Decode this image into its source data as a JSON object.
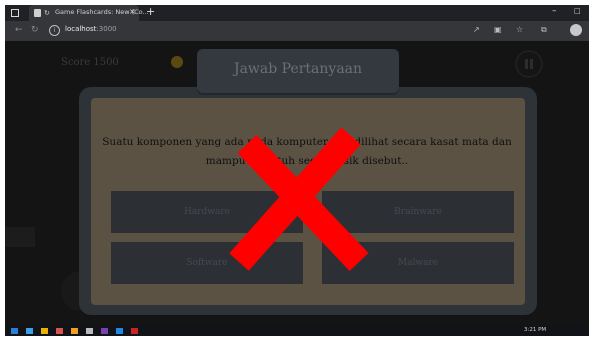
{
  "browser": {
    "tab_title": "Game Flashcards: New (Co...",
    "new_tab": "+",
    "close_tab": "×",
    "url_host": "localhost",
    "url_port": ":3000",
    "win_min": "–",
    "win_max": "□"
  },
  "hud": {
    "score": "Score 1500"
  },
  "modal": {
    "title": "Jawab Pertanyaan",
    "question": "Suatu komponen yang ada pada komputer dan dilihat secara kasat mata dan mampu disentuh secara fisik disebut..",
    "answers": [
      "Hardware",
      "Brainware",
      "Software",
      "Malware"
    ],
    "result_icon": "wrong-cross-icon",
    "result_color": "#ff0000"
  },
  "taskbar": {
    "clock": "3:21 PM"
  }
}
